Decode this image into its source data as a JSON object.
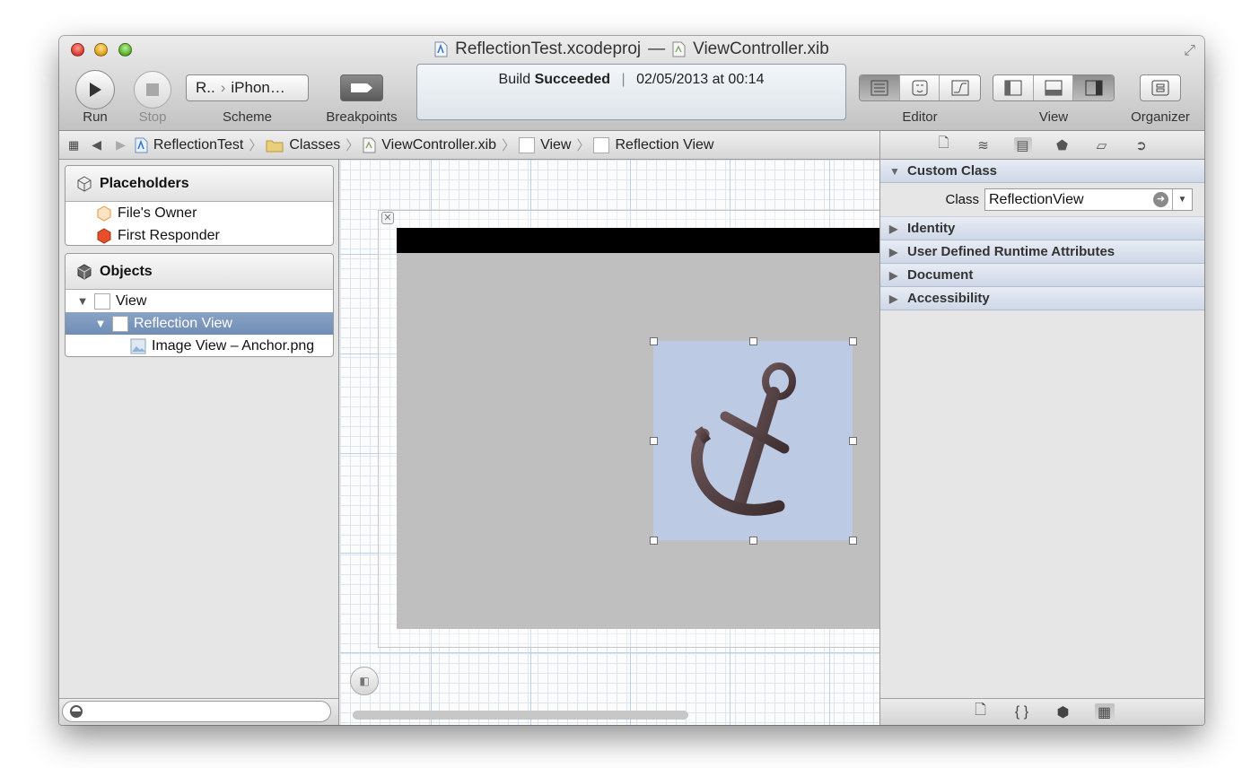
{
  "window": {
    "title_project": "ReflectionTest.xcodeproj",
    "title_dash": "—",
    "title_file": "ViewController.xib"
  },
  "toolbar": {
    "run_label": "Run",
    "stop_label": "Stop",
    "scheme_target": "R..",
    "scheme_device": "iPhon…",
    "scheme_label": "Scheme",
    "breakpoints_label": "Breakpoints",
    "editor_label": "Editor",
    "view_label": "View",
    "organizer_label": "Organizer"
  },
  "activity": {
    "prefix": "Build",
    "status": "Succeeded",
    "separator": "|",
    "timestamp": "02/05/2013 at 00:14"
  },
  "jumpbar": {
    "items": [
      "ReflectionTest",
      "Classes",
      "ViewController.xib",
      "View",
      "Reflection View"
    ]
  },
  "outline": {
    "placeholders_title": "Placeholders",
    "placeholders": [
      "File's Owner",
      "First Responder"
    ],
    "objects_title": "Objects",
    "objects": [
      "View",
      "Reflection View",
      "Image View – Anchor.png"
    ]
  },
  "inspector": {
    "custom_class_title": "Custom Class",
    "class_label": "Class",
    "class_value": "ReflectionView",
    "sections": [
      "Identity",
      "User Defined Runtime Attributes",
      "Document",
      "Accessibility"
    ]
  },
  "colors": {
    "selection": "#7893b9",
    "image_background": "#bccae4",
    "anchor": "#5a4648"
  }
}
